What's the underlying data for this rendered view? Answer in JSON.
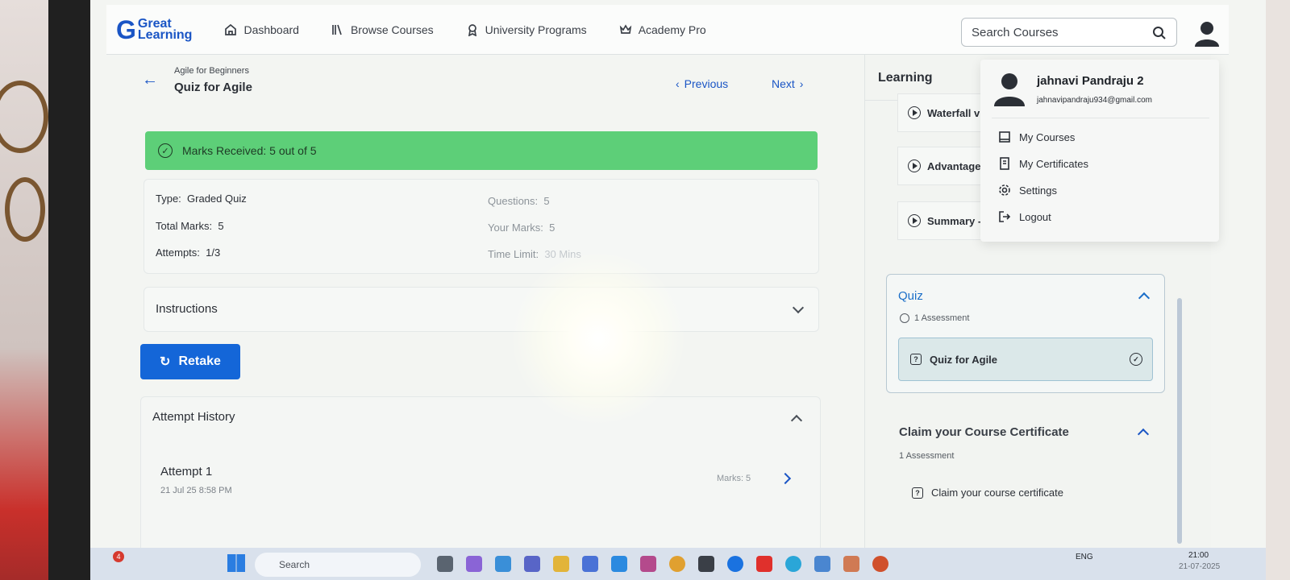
{
  "nav": {
    "logo_line1": "Great",
    "logo_line2": "Learning",
    "items": [
      {
        "label": "Dashboard",
        "icon": "home-icon"
      },
      {
        "label": "Browse Courses",
        "icon": "library-icon"
      },
      {
        "label": "University Programs",
        "icon": "award-icon"
      },
      {
        "label": "Academy Pro",
        "icon": "crown-icon"
      }
    ],
    "search_placeholder": "Search Courses"
  },
  "page": {
    "breadcrumb": "Agile for Beginners",
    "title": "Quiz for Agile",
    "previous_label": "Previous",
    "next_label": "Next"
  },
  "result": {
    "banner": "Marks Received: 5 out of 5",
    "type_label": "Type:",
    "type_value": "Graded Quiz",
    "total_marks_label": "Total Marks:",
    "total_marks_value": "5",
    "attempts_label": "Attempts:",
    "attempts_value": "1/3",
    "questions_label": "Questions:",
    "questions_value": "5",
    "your_marks_label": "Your Marks:",
    "your_marks_value": "5",
    "time_limit_label": "Time Limit:",
    "time_limit_value": "30 Mins"
  },
  "instructions_label": "Instructions",
  "retake_label": "Retake",
  "history": {
    "title": "Attempt History",
    "attempts": [
      {
        "name": "Attempt 1",
        "date": "21 Jul 25 8:58 PM",
        "marks": "Marks: 5"
      }
    ]
  },
  "sidebar": {
    "title": "Learning",
    "videos": [
      "Waterfall v",
      "Advantage",
      "Summary -"
    ],
    "quiz_section": {
      "label": "Quiz",
      "count": "1 Assessment",
      "item": "Quiz for Agile"
    },
    "certificate_section": {
      "label": "Claim your Course Certificate",
      "count": "1 Assessment",
      "item": "Claim your course certificate"
    }
  },
  "user_menu": {
    "name": "jahnavi Pandraju 2",
    "email": "jahnavipandraju934@gmail.com",
    "items": [
      "My Courses",
      "My Certificates",
      "Settings",
      "Logout"
    ]
  },
  "taskbar": {
    "search_placeholder": "Search",
    "notification_count": "4",
    "language": "ENG",
    "time": "21:00",
    "date": "21-07-2025"
  },
  "colors": {
    "accent": "#1466d8",
    "success_banner": "#5dcf78",
    "link": "#1a55c5"
  }
}
